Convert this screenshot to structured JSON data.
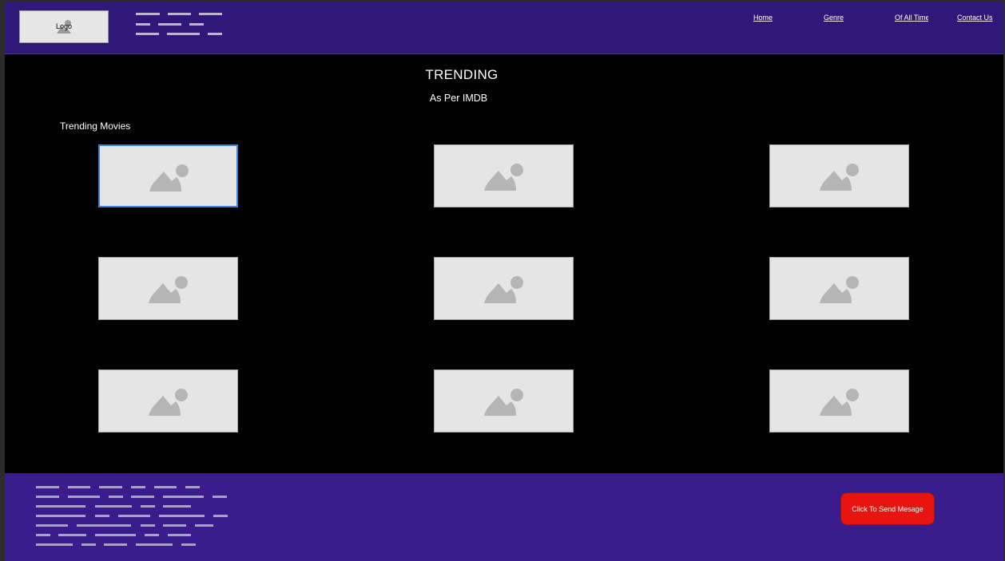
{
  "header": {
    "logo_label": "Logo",
    "nav": [
      {
        "label": "Home"
      },
      {
        "label": "Genre"
      },
      {
        "label": "Of All Time"
      },
      {
        "label": "Contact Us"
      }
    ]
  },
  "main": {
    "title": "TRENDING",
    "subtitle": "As Per IMDB",
    "section_label": "Trending Movies",
    "thumbnails_icon": "image-placeholder-icon"
  },
  "footer": {
    "send_button_label": "Click To Send Mesage"
  },
  "colors": {
    "header_bg": "#2f1878",
    "footer_bg": "#3a1c8c",
    "page_bg": "#000000",
    "button_red": "#e8140f",
    "selected_border": "#3d7fd9"
  }
}
